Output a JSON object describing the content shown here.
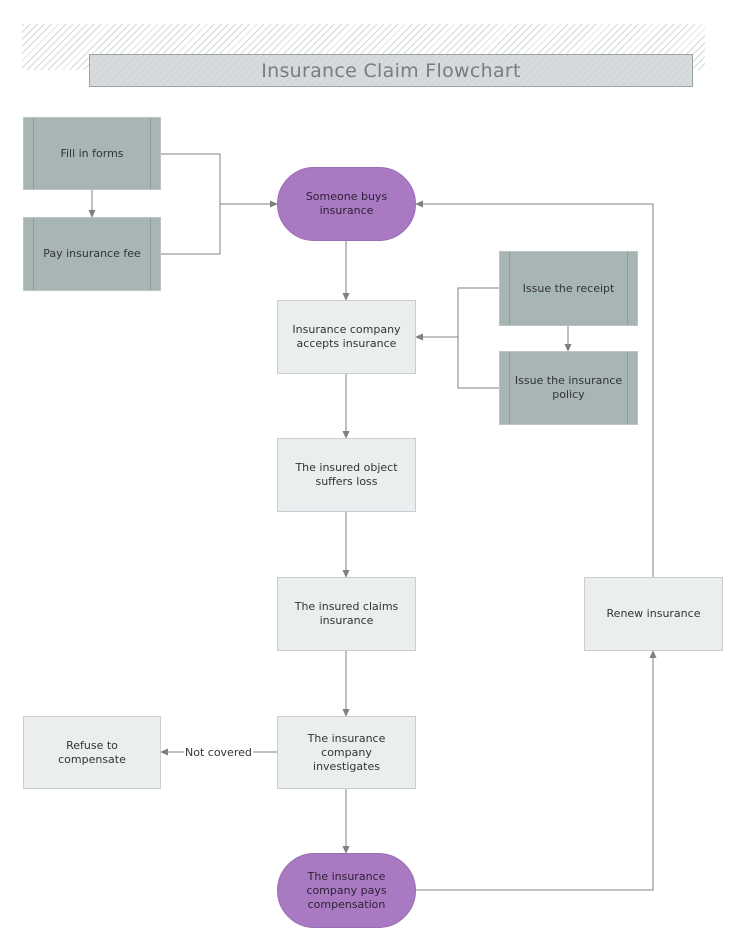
{
  "title": "Insurance Claim Flowchart",
  "colors": {
    "terminal_fill": "#a97ac2",
    "process_fill": "#ebeeef",
    "predefined_fill": "#a7b6b4",
    "connector": "#808080",
    "title_text": "#7a7d80"
  },
  "nodes": {
    "fill_forms": {
      "label": "Fill in forms",
      "shape": "predefined-process"
    },
    "pay_fee": {
      "label": "Pay insurance fee",
      "shape": "predefined-process"
    },
    "buys": {
      "label": "Someone buys insurance",
      "shape": "terminal"
    },
    "accepts": {
      "label": "Insurance company accepts insurance",
      "shape": "process"
    },
    "receipt": {
      "label": "Issue the receipt",
      "shape": "predefined-process"
    },
    "policy": {
      "label": "Issue the insurance policy",
      "shape": "predefined-process"
    },
    "loss": {
      "label": "The insured object suffers loss",
      "shape": "process"
    },
    "claims": {
      "label": "The insured claims insurance",
      "shape": "process"
    },
    "investigates": {
      "label": "The insurance company investigates",
      "shape": "process"
    },
    "refuse": {
      "label": "Refuse to compensate",
      "shape": "process"
    },
    "pays": {
      "label": "The insurance company pays compensation",
      "shape": "terminal"
    },
    "renew": {
      "label": "Renew insurance",
      "shape": "process"
    }
  },
  "edges": [
    {
      "from": "fill_forms",
      "to": "pay_fee",
      "label": ""
    },
    {
      "from": "fill_forms",
      "to": "buys",
      "label": ""
    },
    {
      "from": "pay_fee",
      "to": "buys",
      "label": ""
    },
    {
      "from": "buys",
      "to": "accepts",
      "label": ""
    },
    {
      "from": "receipt",
      "to": "policy",
      "label": ""
    },
    {
      "from": "receipt",
      "to": "accepts",
      "label": ""
    },
    {
      "from": "policy",
      "to": "accepts",
      "label": ""
    },
    {
      "from": "accepts",
      "to": "loss",
      "label": ""
    },
    {
      "from": "loss",
      "to": "claims",
      "label": ""
    },
    {
      "from": "claims",
      "to": "investigates",
      "label": ""
    },
    {
      "from": "investigates",
      "to": "refuse",
      "label": "Not covered"
    },
    {
      "from": "investigates",
      "to": "pays",
      "label": ""
    },
    {
      "from": "pays",
      "to": "renew",
      "label": ""
    },
    {
      "from": "renew",
      "to": "buys",
      "label": ""
    }
  ]
}
